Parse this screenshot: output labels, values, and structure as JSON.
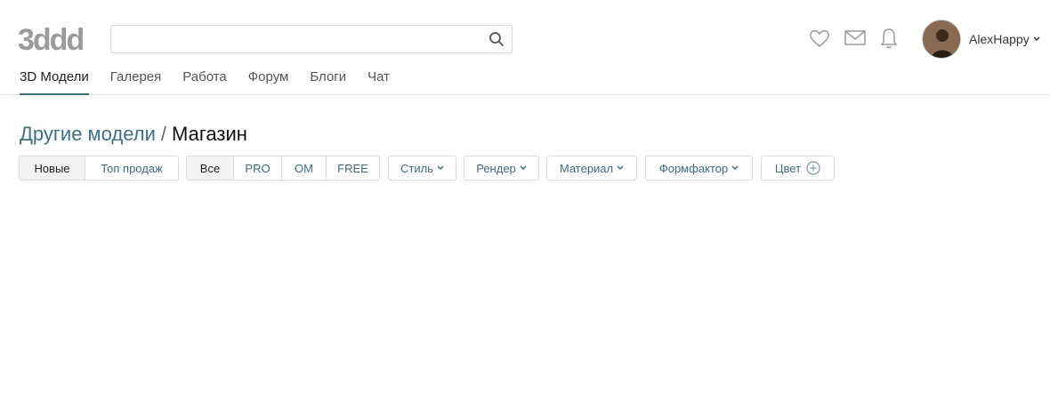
{
  "logo": {
    "text": "3ddd"
  },
  "search": {
    "value": "",
    "placeholder": ""
  },
  "header_icons": [
    "heart-icon",
    "mail-icon",
    "bell-icon"
  ],
  "user": {
    "name": "AlexHappy"
  },
  "nav": {
    "items": [
      {
        "label": "3D Модели",
        "active": true
      },
      {
        "label": "Галерея"
      },
      {
        "label": "Работа"
      },
      {
        "label": "Форум"
      },
      {
        "label": "Блоги"
      },
      {
        "label": "Чат"
      }
    ]
  },
  "breadcrumb": {
    "parent": "Другие модели",
    "separator": "/",
    "current": "Магазин"
  },
  "filters": {
    "sort": [
      "Новые",
      "Топ продаж"
    ],
    "license": [
      "Все",
      "PRO",
      "OM",
      "FREE"
    ],
    "style": "Стиль",
    "render": "Рендер",
    "material": "Материал",
    "formfactor": "Формфактор",
    "color": "Цвет"
  },
  "colors": {
    "accent": "#3e7085",
    "link": "#3e6b80",
    "divider": "#e3e3e3"
  }
}
